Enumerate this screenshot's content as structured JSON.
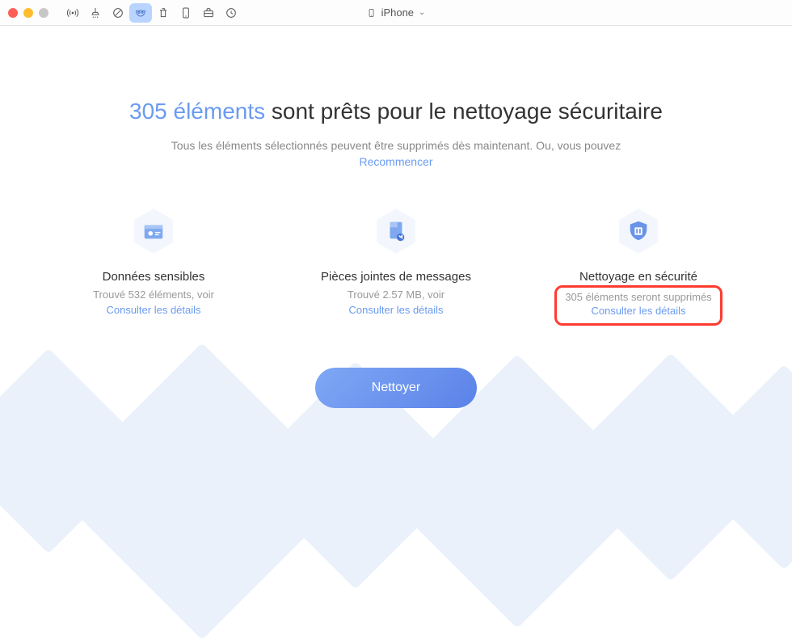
{
  "titlebar": {
    "device_label": "iPhone"
  },
  "headline": {
    "accent": "305 éléments",
    "rest": " sont prêts pour le nettoyage sécuritaire"
  },
  "subtitle": "Tous les éléments sélectionnés peuvent être supprimés dès maintenant. Ou, vous pouvez",
  "restart_label": "Recommencer",
  "cards": {
    "sensitive": {
      "title": "Données sensibles",
      "found": "Trouvé 532 éléments, voir",
      "link": "Consulter les détails"
    },
    "attachments": {
      "title": "Pièces jointes de messages",
      "found": "Trouvé 2.57 MB, voir",
      "link": "Consulter les détails"
    },
    "secure": {
      "title": "Nettoyage en sécurité",
      "found": "305 éléments seront supprimés",
      "link": "Consulter les détails"
    }
  },
  "clean_button": "Nettoyer",
  "colors": {
    "accent": "#6a9bf0",
    "highlight": "#ff3b30"
  }
}
